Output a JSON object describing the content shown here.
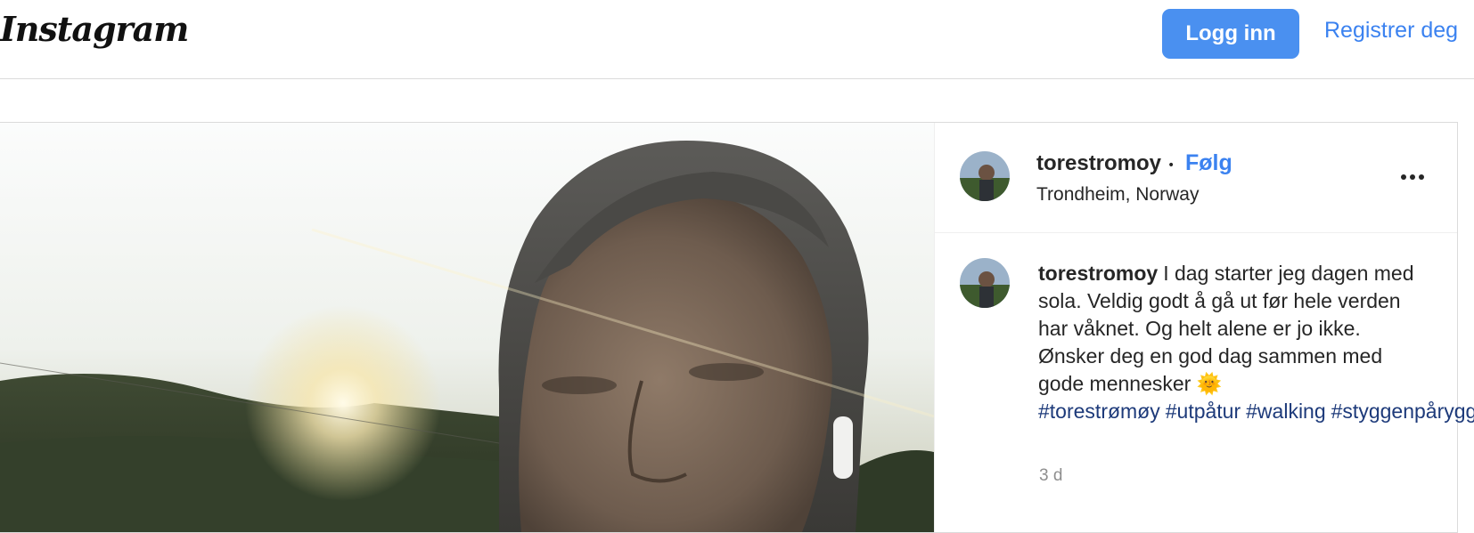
{
  "header": {
    "logo": "Instagram",
    "login_label": "Logg inn",
    "register_label": "Registrer deg"
  },
  "post": {
    "username": "torestromoy",
    "separator": "•",
    "follow_label": "Følg",
    "location": "Trondheim, Norway",
    "more_icon": "more-horizontal-icon",
    "caption_text": "I dag starter jeg dagen med sola. Veldig godt å gå ut før hele verden har våknet. Og helt alene er jo ikke. Ønsker deg en god dag sammen med gode mennesker 🌞",
    "hashtags": [
      "#torestrømøy",
      "#utpåtur",
      "#walking",
      "#styggenpåryggen"
    ],
    "time": "3 d"
  },
  "colors": {
    "accent": "#4a90f0",
    "link": "#3b82f0",
    "hashtag": "#1d3a7a",
    "border": "#dbdbdb",
    "muted": "#8e8e8e"
  }
}
